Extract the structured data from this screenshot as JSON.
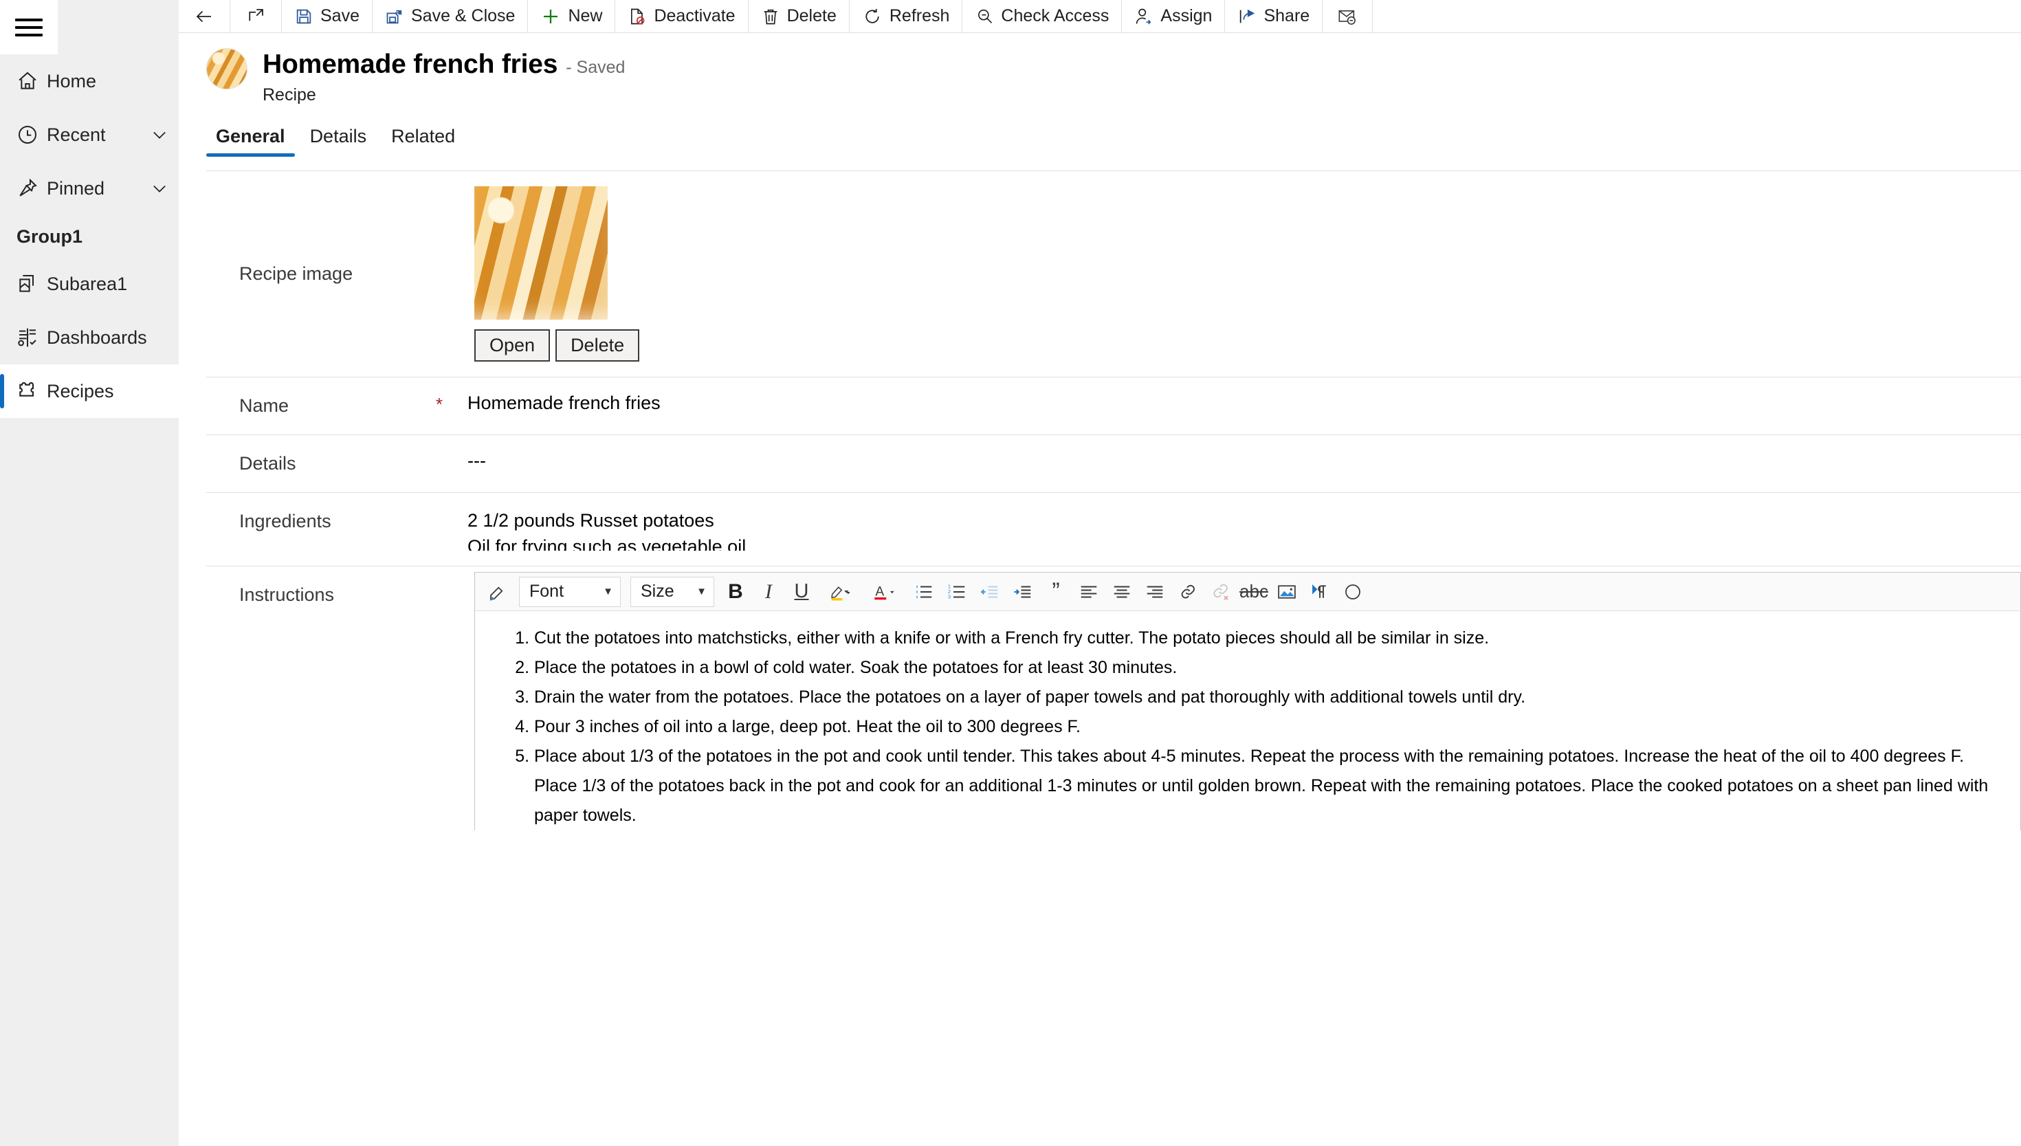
{
  "sidebar": {
    "hamburger_label": "site-map-toggle",
    "items": [
      {
        "label": "Home",
        "icon": "home-icon",
        "expandable": false,
        "selected": false
      },
      {
        "label": "Recent",
        "icon": "clock-icon",
        "expandable": true,
        "selected": false
      },
      {
        "label": "Pinned",
        "icon": "pin-icon",
        "expandable": true,
        "selected": false
      }
    ],
    "group_label": "Group1",
    "group_items": [
      {
        "label": "Subarea1",
        "icon": "pages-icon",
        "selected": false
      },
      {
        "label": "Dashboards",
        "icon": "dashboard-icon",
        "selected": false
      },
      {
        "label": "Recipes",
        "icon": "puzzle-icon",
        "selected": true
      }
    ]
  },
  "commandbar": {
    "back_label": "Back",
    "popout_label": "Open in new window",
    "items": [
      {
        "label": "Save",
        "icon": "save-icon"
      },
      {
        "label": "Save & Close",
        "icon": "save-close-icon"
      },
      {
        "label": "New",
        "icon": "plus-icon"
      },
      {
        "label": "Deactivate",
        "icon": "deactivate-icon"
      },
      {
        "label": "Delete",
        "icon": "trash-icon"
      },
      {
        "label": "Refresh",
        "icon": "refresh-icon"
      },
      {
        "label": "Check Access",
        "icon": "key-search-icon"
      },
      {
        "label": "Assign",
        "icon": "person-assign-icon"
      },
      {
        "label": "Share",
        "icon": "share-icon"
      },
      {
        "label": "",
        "icon": "email-link-icon"
      }
    ]
  },
  "record": {
    "title": "Homemade french fries",
    "saved_status": "- Saved",
    "entity": "Recipe",
    "avatar_name": "recipe-avatar"
  },
  "tabs": [
    {
      "label": "General",
      "active": true
    },
    {
      "label": "Details",
      "active": false
    },
    {
      "label": "Related",
      "active": false
    }
  ],
  "form": {
    "image_field": {
      "label": "Recipe image",
      "open_label": "Open",
      "delete_label": "Delete"
    },
    "name_field": {
      "label": "Name",
      "required_mark": "*",
      "value": "Homemade french fries"
    },
    "details_field": {
      "label": "Details",
      "value": "---"
    },
    "ingredients_field": {
      "label": "Ingredients",
      "line1": "2 1/2 pounds Russet potatoes",
      "line2": "Oil for frying such as vegetable oil"
    },
    "instructions_field": {
      "label": "Instructions",
      "toolbar": {
        "format_painter": "format-painter-icon",
        "font_label": "Font",
        "size_label": "Size",
        "bold": "B",
        "italic": "I",
        "underline": "U",
        "highlight": "highlight-icon",
        "font_color": "A",
        "bullet_list": "bullet-list-icon",
        "numbered_list": "numbered-list-icon",
        "decrease_indent": "decrease-indent-icon",
        "increase_indent": "increase-indent-icon",
        "blockquote": "quote-icon",
        "align_left": "align-left-icon",
        "align_center": "align-center-icon",
        "align_right": "align-right-icon",
        "insert_link": "link-icon",
        "remove_link": "unlink-icon",
        "strikethrough": "abc",
        "insert_image": "image-icon",
        "rtl": "rtl-paragraph-icon"
      },
      "steps": [
        "Cut the potatoes into matchsticks, either with a knife or with a French fry cutter. The potato pieces should all be similar in size.",
        "Place the potatoes in a bowl of cold water. Soak the potatoes for at least 30 minutes.",
        "Drain the water from the potatoes. Place the potatoes on a layer of paper towels and pat thoroughly with additional towels until dry.",
        "Pour 3 inches of oil into a large, deep pot. Heat the oil to 300 degrees F.",
        "Place about 1/3 of the potatoes in the pot and cook until tender. This takes about 4-5 minutes. Repeat the process with the remaining potatoes. Increase the heat of the oil to 400 degrees F. Place 1/3 of the potatoes back in the pot and cook for an additional 1-3 minutes or until golden brown. Repeat with the remaining potatoes. Place the cooked potatoes on a sheet pan lined with paper towels."
      ]
    }
  },
  "colors": {
    "accent": "#0f6cbd",
    "sidebar_bg": "#efefef",
    "required": "#a4262c",
    "divider": "#e1dfdd",
    "highlight_yellow": "#ffc400",
    "font_color_red": "#e81123",
    "new_green": "#107c10"
  }
}
